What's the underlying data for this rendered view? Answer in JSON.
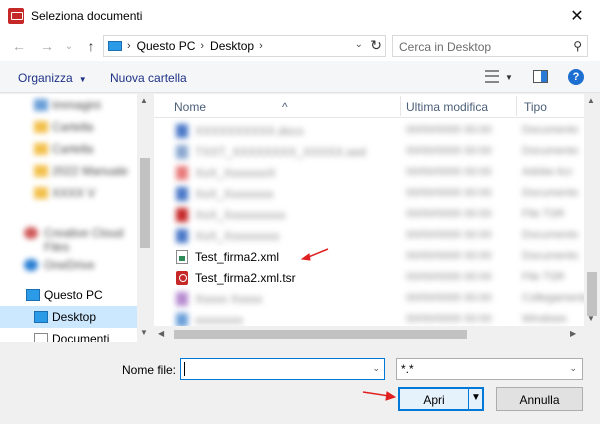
{
  "window": {
    "title": "Seleziona documenti",
    "close_glyph": "✕"
  },
  "nav": {
    "back_glyph": "←",
    "forward_glyph": "→",
    "recent_glyph": "⌄",
    "up_glyph": "↑",
    "breadcrumbs": [
      "Questo PC",
      "Desktop"
    ],
    "crumb_sep": "›",
    "dropdown_glyph": "⌄",
    "refresh_glyph": "↻",
    "search_placeholder": "Cerca in Desktop",
    "search_glyph": "⚲"
  },
  "toolbar": {
    "organize_label": "Organizza",
    "organize_dd": "▼",
    "new_folder_label": "Nuova cartella",
    "view_dd": "▼",
    "help_glyph": "?"
  },
  "sidebar": {
    "items": [
      {
        "label": "Immagini",
        "blurred": true
      },
      {
        "label": "Cartella",
        "blurred": true
      },
      {
        "label": "Cartella",
        "blurred": true
      },
      {
        "label": "2022 Manuale",
        "blurred": true
      },
      {
        "label": "XXXX V",
        "blurred": true
      },
      {
        "label": "Creative Cloud Files",
        "blurred": true
      },
      {
        "label": "OneDrive",
        "blurred": true
      },
      {
        "label": "Questo PC",
        "blurred": false
      },
      {
        "label": "Desktop",
        "blurred": false,
        "selected": true
      },
      {
        "label": "Documenti",
        "blurred": false
      }
    ],
    "scroll_up": "▲",
    "scroll_down": "▼"
  },
  "files": {
    "columns": {
      "name": "Nome",
      "modified": "Ultima modifica",
      "type": "Tipo"
    },
    "sort_glyph": "^",
    "rows": [
      {
        "name": "XXXXXXXXXX.docx",
        "date": "00/00/0000 00:00",
        "type": "Documento",
        "blurred": true
      },
      {
        "name": "TXXT_XXXXXXXX_XXXXX.sed",
        "date": "00/00/0000 00:00",
        "type": "Documento",
        "blurred": true
      },
      {
        "name": "XxX_XxxxxxxX",
        "date": "00/00/0000 00:00",
        "type": "Adobe Acr",
        "blurred": true
      },
      {
        "name": "XxX_Xxxxxxxx",
        "date": "00/00/0000 00:00",
        "type": "Documento",
        "blurred": true
      },
      {
        "name": "XxX_Xxxxxxxxxx",
        "date": "00/00/0000 00:00",
        "type": "File TSR",
        "blurred": true
      },
      {
        "name": "XxX_Xxxxxxxxx",
        "date": "00/00/0000 00:00",
        "type": "Documento",
        "blurred": true
      },
      {
        "name": "Test_firma2.xml",
        "date": "00/00/0000 00:00",
        "type": "Documento",
        "blurred": false,
        "icon": "xml"
      },
      {
        "name": "Test_firma2.xml.tsr",
        "date": "00/00/0000 00:00",
        "type": "File TSR",
        "blurred": false,
        "icon": "tsr"
      },
      {
        "name": "Xxxxx Xxxxx",
        "date": "00/00/0000 00:00",
        "type": "Collegamento",
        "blurred": true
      },
      {
        "name": "xxxxxxxx",
        "date": "00/00/0000 00:00",
        "type": "Windows",
        "blurred": true
      }
    ],
    "scroll_up": "▲",
    "scroll_down": "▼",
    "scroll_left": "◀",
    "scroll_right": "▶"
  },
  "bottom": {
    "filename_label": "Nome file:",
    "filename_value": "",
    "filename_dd": "⌄",
    "filetype_value": "*.*",
    "filetype_dd": "⌄",
    "open_label": "Apri",
    "open_dd": "▼",
    "cancel_label": "Annulla"
  },
  "colors": {
    "accent": "#0078d7",
    "selection": "#cce8ff",
    "arrow": "#e02020",
    "header_text": "#4c607a",
    "link_text": "#1e3287"
  }
}
